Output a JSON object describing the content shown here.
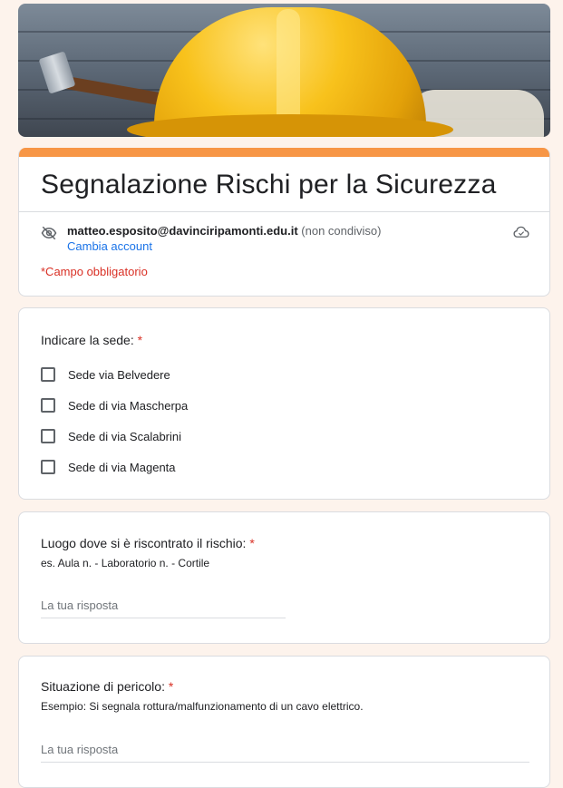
{
  "form": {
    "title": "Segnalazione Rischi per la Sicurezza",
    "account_email": "matteo.esposito@davinciripamonti.edu.it",
    "account_status": "(non condiviso)",
    "switch_account": "Cambia account",
    "required_note": "*Campo obbligatorio",
    "accent_color": "#f79646",
    "background_color": "#fdf3ec"
  },
  "questions": [
    {
      "title": "Indicare la sede:",
      "required": "*",
      "options": [
        "Sede via Belvedere",
        "Sede di via Mascherpa",
        "Sede di via Scalabrini",
        "Sede di via Magenta"
      ]
    },
    {
      "title": "Luogo dove si è riscontrato il rischio:",
      "required": "*",
      "help": "es. Aula n. - Laboratorio n. - Cortile",
      "placeholder": "La tua risposta"
    },
    {
      "title": "Situazione di pericolo:",
      "required": "*",
      "help": "Esempio: Si segnala rottura/malfunzionamento di un cavo elettrico.",
      "placeholder": "La tua risposta"
    }
  ],
  "icons": {
    "account": "eye-off-icon",
    "save_status": "cloud-icon"
  }
}
